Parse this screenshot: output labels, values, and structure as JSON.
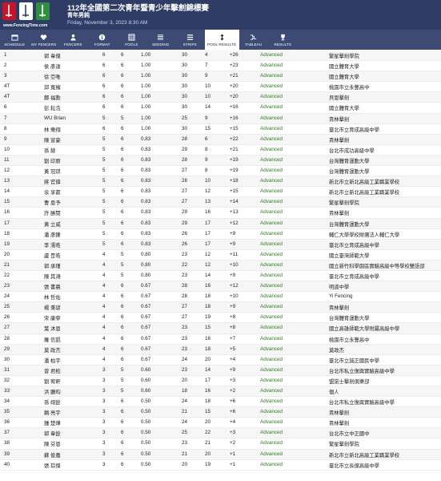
{
  "header": {
    "logo_site": "www.FencingTime.com",
    "title": "112年全國第二次青年暨青少年擊劍錦標賽",
    "subtitle": "青年男鈍",
    "date": "Friday, November 3, 2023 8:30 AM"
  },
  "nav": [
    {
      "label": "SCHEDULE",
      "icon": "calendar-icon"
    },
    {
      "label": "MY FENCERS",
      "icon": "heart-icon"
    },
    {
      "label": "FENCERS",
      "icon": "person-icon"
    },
    {
      "label": "FORMAT",
      "icon": "info-icon"
    },
    {
      "label": "POOLS",
      "icon": "grid-icon"
    },
    {
      "label": "SEEDING",
      "icon": "list-icon"
    },
    {
      "label": "STRIPS",
      "icon": "strips-icon"
    },
    {
      "label": "POOL RESULTS",
      "icon": "sort-icon",
      "active": true
    },
    {
      "label": "TABLEAU",
      "icon": "tableau-icon"
    },
    {
      "label": "RESULTS",
      "icon": "trophy-icon"
    }
  ],
  "rows": [
    {
      "place": "1",
      "name": "郭 韋傑",
      "v": "6",
      "m": "6",
      "ind": "1.00",
      "ts": "30",
      "tr": "4",
      "diff": "+26",
      "status": "Advanced",
      "club": "繁星擊劍學院"
    },
    {
      "place": "2",
      "name": "侯 彥達",
      "v": "6",
      "m": "6",
      "ind": "1.00",
      "ts": "30",
      "tr": "7",
      "diff": "+23",
      "status": "Advanced",
      "club": "國立體育大學"
    },
    {
      "place": "3",
      "name": "徐 亞唯",
      "v": "6",
      "m": "6",
      "ind": "1.00",
      "ts": "30",
      "tr": "9",
      "diff": "+21",
      "status": "Advanced",
      "club": "國立體育大學"
    },
    {
      "place": "4T",
      "name": "邱 寬擁",
      "v": "6",
      "m": "6",
      "ind": "1.00",
      "ts": "30",
      "tr": "10",
      "diff": "+20",
      "status": "Advanced",
      "club": "桃園市立永豐高中"
    },
    {
      "place": "4T",
      "name": "鄭 福勳",
      "v": "6",
      "m": "6",
      "ind": "1.00",
      "ts": "30",
      "tr": "10",
      "diff": "+20",
      "status": "Advanced",
      "club": "貝恩擊劍"
    },
    {
      "place": "6",
      "name": "彭 耘浩",
      "v": "6",
      "m": "6",
      "ind": "1.00",
      "ts": "30",
      "tr": "14",
      "diff": "+16",
      "status": "Advanced",
      "club": "國立體育大學"
    },
    {
      "place": "7",
      "name": "WU Brian",
      "v": "5",
      "m": "5",
      "ind": "1.00",
      "ts": "25",
      "tr": "9",
      "diff": "+16",
      "status": "Advanced",
      "club": "貴林擊劍"
    },
    {
      "place": "8",
      "name": "林 樂翔",
      "v": "6",
      "m": "6",
      "ind": "1.00",
      "ts": "30",
      "tr": "15",
      "diff": "+15",
      "status": "Advanced",
      "club": "臺北市立育成高級中學"
    },
    {
      "place": "9",
      "name": "陳 宣豪",
      "v": "5",
      "m": "6",
      "ind": "0.83",
      "ts": "28",
      "tr": "6",
      "diff": "+22",
      "status": "Advanced",
      "club": "貴林擊劍"
    },
    {
      "place": "10",
      "name": "孫 赫",
      "v": "5",
      "m": "6",
      "ind": "0.83",
      "ts": "29",
      "tr": "8",
      "diff": "+21",
      "status": "Advanced",
      "club": "台北市成功高級中學"
    },
    {
      "place": "11",
      "name": "劉 印原",
      "v": "5",
      "m": "6",
      "ind": "0.83",
      "ts": "28",
      "tr": "9",
      "diff": "+19",
      "status": "Advanced",
      "club": "台灣體育運動大學"
    },
    {
      "place": "12",
      "name": "黃 冠琪",
      "v": "5",
      "m": "6",
      "ind": "0.83",
      "ts": "27",
      "tr": "8",
      "diff": "+19",
      "status": "Advanced",
      "club": "台灣體育運動大學"
    },
    {
      "place": "13",
      "name": "蔣 官鋒",
      "v": "5",
      "m": "6",
      "ind": "0.83",
      "ts": "28",
      "tr": "10",
      "diff": "+18",
      "status": "Advanced",
      "club": "新北市立新北高級工業職業學校"
    },
    {
      "place": "14",
      "name": "余 享叡",
      "v": "5",
      "m": "6",
      "ind": "0.83",
      "ts": "27",
      "tr": "12",
      "diff": "+15",
      "status": "Advanced",
      "club": "新北市立新北高級工業職業學校"
    },
    {
      "place": "15",
      "name": "曹 恩予",
      "v": "5",
      "m": "6",
      "ind": "0.83",
      "ts": "27",
      "tr": "13",
      "diff": "+14",
      "status": "Advanced",
      "club": "繁星擊劍學院"
    },
    {
      "place": "16",
      "name": "許 勝閔",
      "v": "5",
      "m": "6",
      "ind": "0.83",
      "ts": "29",
      "tr": "16",
      "diff": "+13",
      "status": "Advanced",
      "club": "貴林擊劍"
    },
    {
      "place": "17",
      "name": "黃 立威",
      "v": "5",
      "m": "6",
      "ind": "0.83",
      "ts": "29",
      "tr": "17",
      "diff": "+12",
      "status": "Advanced",
      "club": "台灣體育運動大學"
    },
    {
      "place": "18",
      "name": "潘 彥鑠",
      "v": "5",
      "m": "6",
      "ind": "0.83",
      "ts": "26",
      "tr": "17",
      "diff": "+9",
      "status": "Advanced",
      "club": "輔仁大學學校財團法人輔仁大學"
    },
    {
      "place": "19",
      "name": "李 濡晧",
      "v": "5",
      "m": "6",
      "ind": "0.83",
      "ts": "26",
      "tr": "17",
      "diff": "+9",
      "status": "Advanced",
      "club": "臺北市立育成高級中學"
    },
    {
      "place": "20",
      "name": "盧 昰皓",
      "v": "4",
      "m": "5",
      "ind": "0.80",
      "ts": "23",
      "tr": "12",
      "diff": "+11",
      "status": "Advanced",
      "club": "國立臺灣師範大學"
    },
    {
      "place": "21",
      "name": "郭 承瑾",
      "v": "4",
      "m": "5",
      "ind": "0.80",
      "ts": "22",
      "tr": "12",
      "diff": "+10",
      "status": "Advanced",
      "club": "國立新竹科學園區實驗高級中等學校雙語部"
    },
    {
      "place": "22",
      "name": "陳 其鴻",
      "v": "4",
      "m": "5",
      "ind": "0.80",
      "ts": "23",
      "tr": "14",
      "diff": "+9",
      "status": "Advanced",
      "club": "臺北市立育成高級中學"
    },
    {
      "place": "23",
      "name": "張 書晨",
      "v": "4",
      "m": "6",
      "ind": "0.67",
      "ts": "28",
      "tr": "16",
      "diff": "+12",
      "status": "Advanced",
      "club": "明道中學"
    },
    {
      "place": "24",
      "name": "林 哲佑",
      "v": "4",
      "m": "6",
      "ind": "0.67",
      "ts": "28",
      "tr": "18",
      "diff": "+10",
      "status": "Advanced",
      "club": "Yi Fencing"
    },
    {
      "place": "25",
      "name": "楊 秉諺",
      "v": "4",
      "m": "6",
      "ind": "0.67",
      "ts": "27",
      "tr": "18",
      "diff": "+9",
      "status": "Advanced",
      "club": "貴林擊劍"
    },
    {
      "place": "26",
      "name": "宋 康寧",
      "v": "4",
      "m": "6",
      "ind": "0.67",
      "ts": "27",
      "tr": "19",
      "diff": "+8",
      "status": "Advanced",
      "club": "台灣體育運動大學"
    },
    {
      "place": "27",
      "name": "葉 沐恩",
      "v": "4",
      "m": "6",
      "ind": "0.67",
      "ts": "23",
      "tr": "15",
      "diff": "+8",
      "status": "Advanced",
      "club": "國立高雄師範大學附屬高級中學"
    },
    {
      "place": "28",
      "name": "羅 信凱",
      "v": "4",
      "m": "6",
      "ind": "0.67",
      "ts": "23",
      "tr": "16",
      "diff": "+7",
      "status": "Advanced",
      "club": "桃園市立永豐高中"
    },
    {
      "place": "29",
      "name": "莫 政杰",
      "v": "4",
      "m": "6",
      "ind": "0.67",
      "ts": "23",
      "tr": "18",
      "diff": "+5",
      "status": "Advanced",
      "club": "莫政杰"
    },
    {
      "place": "30",
      "name": "潘 柏宇",
      "v": "4",
      "m": "6",
      "ind": "0.67",
      "ts": "24",
      "tr": "20",
      "diff": "+4",
      "status": "Advanced",
      "club": "臺北市立誠正國民中學"
    },
    {
      "place": "31",
      "name": "曾 君柘",
      "v": "3",
      "m": "5",
      "ind": "0.60",
      "ts": "23",
      "tr": "14",
      "diff": "+9",
      "status": "Advanced",
      "club": "台北市私立復興實驗高級中學"
    },
    {
      "place": "32",
      "name": "劉 宥軒",
      "v": "3",
      "m": "5",
      "ind": "0.60",
      "ts": "20",
      "tr": "17",
      "diff": "+3",
      "status": "Advanced",
      "club": "盟諾士擊劍俱樂部"
    },
    {
      "place": "33",
      "name": "洪 鵬昀",
      "v": "3",
      "m": "5",
      "ind": "0.60",
      "ts": "18",
      "tr": "16",
      "diff": "+2",
      "status": "Advanced",
      "club": "個人"
    },
    {
      "place": "34",
      "name": "孫 翊銓",
      "v": "3",
      "m": "6",
      "ind": "0.50",
      "ts": "24",
      "tr": "18",
      "diff": "+6",
      "status": "Advanced",
      "club": "台北市私立復興實驗高級中學"
    },
    {
      "place": "35",
      "name": "賴 亮宇",
      "v": "3",
      "m": "6",
      "ind": "0.50",
      "ts": "21",
      "tr": "15",
      "diff": "+6",
      "status": "Advanced",
      "club": "貴林擊劍"
    },
    {
      "place": "36",
      "name": "鍾 楚燁",
      "v": "3",
      "m": "6",
      "ind": "0.50",
      "ts": "24",
      "tr": "20",
      "diff": "+4",
      "status": "Advanced",
      "club": "貴林擊劍"
    },
    {
      "place": "37",
      "name": "郭 韋銓",
      "v": "3",
      "m": "6",
      "ind": "0.50",
      "ts": "25",
      "tr": "22",
      "diff": "+3",
      "status": "Advanced",
      "club": "台北市立中正國中"
    },
    {
      "place": "38",
      "name": "陳 芬恩",
      "v": "3",
      "m": "6",
      "ind": "0.50",
      "ts": "23",
      "tr": "21",
      "diff": "+2",
      "status": "Advanced",
      "club": "繁星擊劍學院"
    },
    {
      "place": "39",
      "name": "蘇 俊嘉",
      "v": "3",
      "m": "6",
      "ind": "0.50",
      "ts": "21",
      "tr": "20",
      "diff": "+1",
      "status": "Advanced",
      "club": "新北市立新北高級工業職業學校"
    },
    {
      "place": "40",
      "name": "張 琮傑",
      "v": "3",
      "m": "6",
      "ind": "0.50",
      "ts": "20",
      "tr": "19",
      "diff": "+1",
      "status": "Advanced",
      "club": "臺北市立長億高級中學"
    }
  ],
  "colors": {
    "header_bg": "#2f3d66",
    "nav_bg": "#3c4a74",
    "status": "#2d7a1f"
  }
}
